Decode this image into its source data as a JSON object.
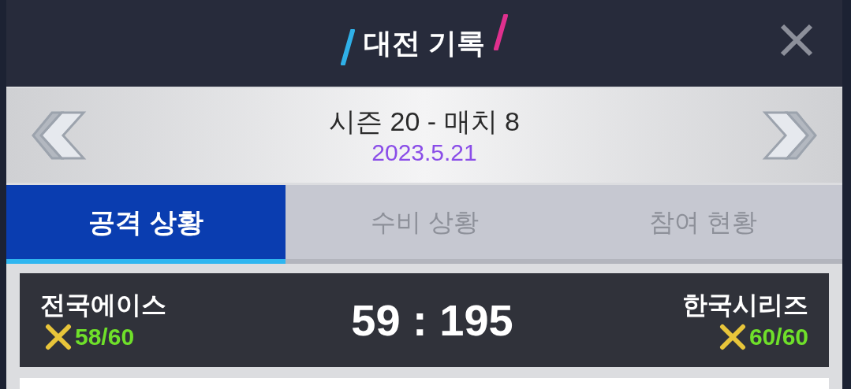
{
  "window": {
    "title": "대전 기록"
  },
  "match_nav": {
    "title": "시즌 20 - 매치 8",
    "date": "2023.5.21"
  },
  "tabs": [
    {
      "label": "공격 상황",
      "selected": true
    },
    {
      "label": "수비 상황",
      "selected": false
    },
    {
      "label": "참여 현황",
      "selected": false
    }
  ],
  "scoreboard": {
    "home": {
      "name": "전국에이스",
      "count": "58/60"
    },
    "score": "59 : 195",
    "away": {
      "name": "한국시리즈",
      "count": "60/60"
    }
  }
}
